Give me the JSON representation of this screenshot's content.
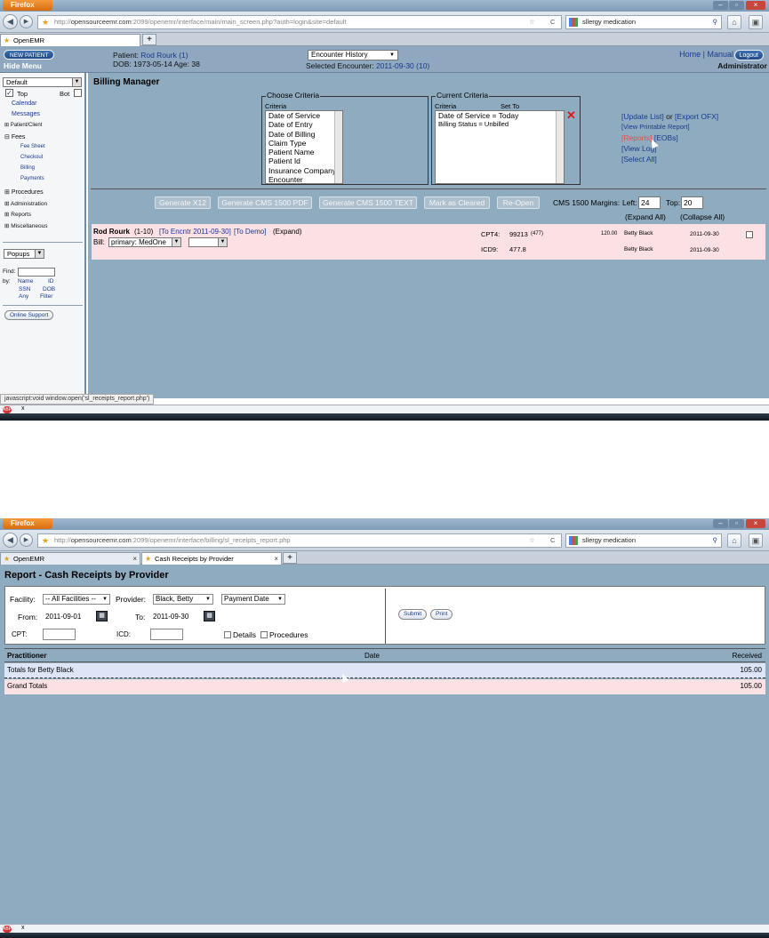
{
  "browser": {
    "menu_label": "Firefox",
    "win_min": "–",
    "win_max": "▫",
    "win_close": "×",
    "search_text": "sllergy medication",
    "back_glyph": "◀",
    "fwd_glyph": "▶",
    "home_glyph": "⌂",
    "bookmark_glyph": "★",
    "reload_glyph": "C",
    "star_glyph": "☆",
    "search_glyph": "⚲",
    "ext_glyph": "▣",
    "tab_close": "×",
    "new_tab": "+",
    "bookmarks_blur": "▪ ▪▪▪ ▪ ▪▪ ▪▪ ▪▪▪▪ ▪▪ ▪▪▪ ▪ ▪▪",
    "addon_label": "ABP",
    "addon_close": "x"
  },
  "screen1": {
    "url_prefix": "http://",
    "url_host": "opensourceemr.com",
    "url_path": ":2099/openemr/interface/main/main_screen.php?auth=login&site=default",
    "tab_label": "OpenEMR",
    "header": {
      "new_patient": "NEW PATIENT",
      "hide_menu": "Hide Menu",
      "patient_label": "Patient:",
      "patient_name": "Rod Rourk (1)",
      "dob": "DOB: 1973-05-14 Age: 38",
      "encounter_history": "Encounter History",
      "selected_encounter_label": "Selected Encounter:",
      "selected_encounter": "2011-09-30 (10)",
      "home": "Home",
      "sep": "|",
      "manual": "Manual",
      "logout": "Logout",
      "user": "Administrator"
    },
    "leftnav": {
      "default_select": "Default",
      "top": "Top",
      "bot": "Bot",
      "check_glyph": "✓",
      "dd_glyph": "▼",
      "items": {
        "calendar": "Calendar",
        "messages": "Messages",
        "patient_client": "Patient/Client",
        "fees": "Fees",
        "fee_sheet": "Fee Sheet",
        "checkout": "Checkout",
        "billing": "Billing",
        "payments": "Payments",
        "procedures": "Procedures",
        "administration": "Administration",
        "reports": "Reports",
        "miscellaneous": "Miscellaneous"
      },
      "plus_glyph": "⊞",
      "minus_glyph": "⊟",
      "popups": "Popups",
      "find": "Find:",
      "by": "by:",
      "name": "Name",
      "id": "ID",
      "ssn": "SSN",
      "dob": "DOB",
      "any": "Any",
      "filter": "Filter",
      "online_support": "Online Support"
    },
    "billing": {
      "title": "Billing Manager",
      "choose_criteria": "Choose Criteria",
      "criteria_col": "Criteria",
      "criteria_options": [
        "Date of Service",
        "Date of Entry",
        "Date of Billing",
        "Claim Type",
        "Patient Name",
        "Patient Id",
        "Insurance Company",
        "Encounter"
      ],
      "current_criteria": "Current Criteria",
      "current_criteria_col": "Criteria",
      "set_to_col": "Set To",
      "current_items": [
        "Date of Service = Today",
        "Billing Status = Unbilled"
      ],
      "remove_glyph": "✕",
      "links": {
        "update_list": "[Update List]",
        "or": "or",
        "export_ofx": "[Export OFX]",
        "view_printable": "[View Printable Report]",
        "reports": "[Reports]",
        "eobs": "[EOBs]",
        "view_log": "[View Log]",
        "select_all": "[Select All]"
      },
      "buttons": [
        "Generate X12",
        "Generate CMS 1500 PDF",
        "Generate CMS 1500 TEXT",
        "Mark as Cleared",
        "Re-Open"
      ],
      "margins_label": "CMS 1500 Margins:",
      "left_label": "Left:",
      "left_value": "24",
      "top_label": "Top:",
      "top_value": "20",
      "expand_all": "(Expand All)",
      "collapse_all": "(Collapse All)",
      "row": {
        "patient": "Rod Rourk",
        "patient_id": "(1-10)",
        "to_encounter": "[To Encntr 2011-09-30]",
        "to_demo": "[To Demo]",
        "expand": "(Expand)",
        "bill_label": "Bill:",
        "bill_value": "primary: MedOne",
        "cpt_label": "CPT4:",
        "cpt_value": "99213",
        "cpt_mod": "(477)",
        "amount": "120.00",
        "provider": "Betty Black",
        "date": "2011-09-30",
        "icd_label": "ICD9:",
        "icd_value": "477.8",
        "provider2": "Betty Black",
        "date2": "2011-09-30"
      }
    },
    "status_text": "javascript:void window.open('sl_receipts_report.php')"
  },
  "screen2": {
    "url_prefix": "http://",
    "url_host": "opensourceemr.com",
    "url_path": ":2099/openemr/interface/billing/sl_receipts_report.php",
    "tabs": [
      "OpenEMR",
      "Cash Receipts by Provider"
    ],
    "title": "Report - Cash Receipts by Provider",
    "form": {
      "facility_label": "Facility:",
      "facility_value": "-- All Facilities --",
      "provider_label": "Provider:",
      "provider_value": "Black, Betty",
      "date_type_value": "Payment Date",
      "from_label": "From:",
      "from_value": "2011-09-01",
      "to_label": "To:",
      "to_value": "2011-09-30",
      "cal_glyph": "▦",
      "cpt_label": "CPT:",
      "icd_label": "ICD:",
      "details_label": "Details",
      "procedures_label": "Procedures",
      "submit": "Submit",
      "print": "Print"
    },
    "table": {
      "headers": [
        "Practitioner",
        "Date",
        "Received"
      ],
      "rows": [
        {
          "label": "Totals for Betty Black",
          "received": "105.00"
        },
        {
          "label": "Grand Totals",
          "received": "105.00"
        }
      ]
    }
  }
}
